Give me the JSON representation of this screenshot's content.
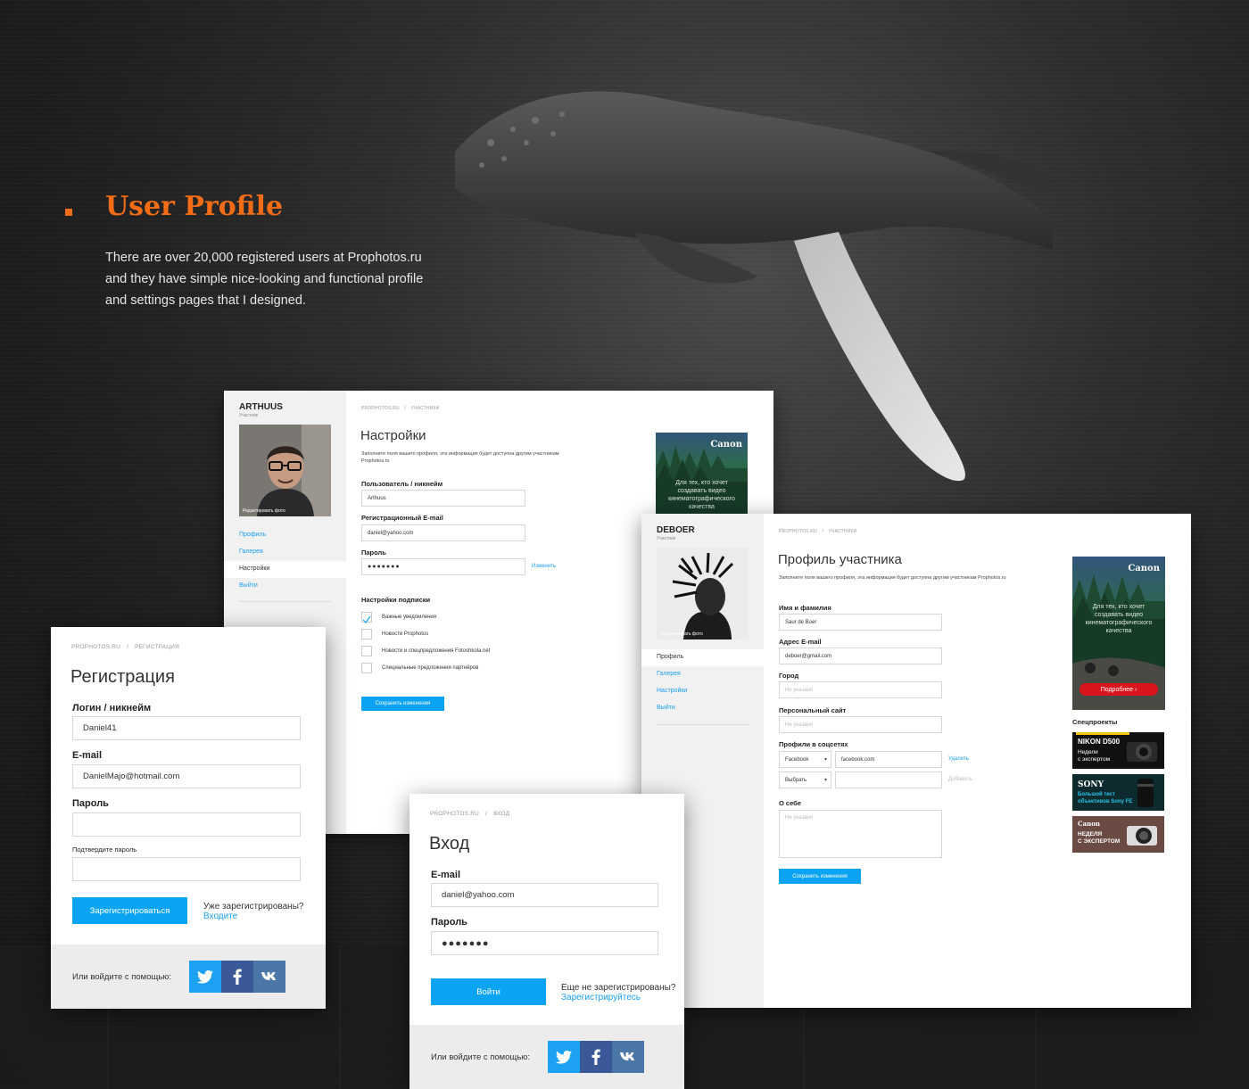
{
  "hero": {
    "title": "User Profile",
    "lines": [
      "There are over 20,000 registered users at Prophotos.ru",
      "and they have simple nice-looking and functional profile",
      "and settings pages that I designed."
    ]
  },
  "settings": {
    "username": "ARTHUUS",
    "role": "Участник",
    "photo_caption": "Редактировать фото",
    "nav": [
      "Профиль",
      "Галерея",
      "Настройки",
      "Выйти"
    ],
    "breadcrumb": [
      "PROPHOTOS.RU",
      "/",
      "УЧАСТНИКИ"
    ],
    "title": "Настройки",
    "description": "Заполните поля вашего профиля, эта информация будет доступна другим участникам Prophotos.ru",
    "fields": {
      "username_label": "Пользователь / никнейм",
      "username_value": "Arthuus",
      "email_label": "Регистрационный E-mail",
      "email_value": "daniel@yahoo.com",
      "password_label": "Пароль",
      "password_value": "●●●●●●●",
      "change_link": "Изменить"
    },
    "subscription_title": "Настройки подписки",
    "subscriptions": [
      {
        "label": "Важные уведомления",
        "checked": true
      },
      {
        "label": "Новости Prophotos",
        "checked": false
      },
      {
        "label": "Новости и спецпредложения Fotoshkola.net",
        "checked": false
      },
      {
        "label": "Специальные предложения партнёров",
        "checked": false
      }
    ],
    "save_button": "Сохранить изменения",
    "ad": {
      "brand": "Canon",
      "text": [
        "Для тех, кто хочет",
        "создавать видео",
        "кинематографического",
        "качества"
      ]
    }
  },
  "profile": {
    "username": "DEBOER",
    "role": "Участник",
    "photo_caption": "Редактировать фото",
    "nav": [
      "Профиль",
      "Галерея",
      "Настройки",
      "Выйти"
    ],
    "breadcrumb": [
      "PROPHOTOS.RU",
      "/",
      "УЧАСТНИКИ"
    ],
    "title": "Профиль участника",
    "description": "Заполните поля вашего профиля, эта информация будет доступна другим участникам Prophotos.ru",
    "fields": {
      "name_label": "Имя и фамилия",
      "name_value": "Saur de Boer",
      "email_label": "Адрес E-mail",
      "email_value": "deboer@gmail.com",
      "city_label": "Город",
      "city_placeholder": "Не указано",
      "site_label": "Персональный сайт",
      "site_placeholder": "Не указано",
      "social_label": "Профили в соцсетях",
      "social_select_1": "Facebook",
      "social_value_1": "facebook.com",
      "social_remove": "Удалить",
      "social_select_2": "Выбрать",
      "social_add": "Добавить",
      "about_label": "О себе",
      "about_placeholder": "Не указано"
    },
    "save_button": "Сохранить изменения",
    "ad": {
      "brand": "Canon",
      "text": [
        "Для тех, кто хочет",
        "создавать видео",
        "кинематографического",
        "качества"
      ],
      "button": "Подробнее ›"
    },
    "special_title": "Спецпроекты",
    "specials": [
      {
        "line1": "NIKON D500",
        "line2": "Недели",
        "line3": "с экспертом"
      },
      {
        "line1": "SONY",
        "line2": "Большой тест",
        "line3": "объективов Sony FE"
      },
      {
        "line1": "Canon",
        "line2": "НЕДЕЛЯ",
        "line3": "С ЭКСПЕРТОМ"
      }
    ]
  },
  "register": {
    "breadcrumb": [
      "PROPHOTOS.RU",
      "/",
      "РЕГИСТРАЦИЯ"
    ],
    "title": "Регистрация",
    "login_label": "Логин / никнейм",
    "login_value": "Daniel41",
    "email_label": "E-mail",
    "email_value": "DanielMajo@hotmail.com",
    "password_label": "Пароль",
    "confirm_label": "Подтвердите пароль",
    "submit": "Зарегистрироваться",
    "already": "Уже зарегистрированы?",
    "login_link": "Входите",
    "social_label": "Или войдите с помощью:"
  },
  "login": {
    "breadcrumb": [
      "PROPHOTOS.RU",
      "/",
      "ВХОД"
    ],
    "title": "Вход",
    "email_label": "E-mail",
    "email_value": "daniel@yahoo.com",
    "password_label": "Пароль",
    "password_value": "●●●●●●●",
    "submit": "Войти",
    "not_registered": "Еще не зарегистрированы?",
    "register_link": "Зарегистрируйтесь",
    "social_label": "Или войдите с помощью:"
  },
  "colors": {
    "accent": "#f36d17",
    "primary": "#0ba3f4",
    "link": "#1a9ff0"
  }
}
